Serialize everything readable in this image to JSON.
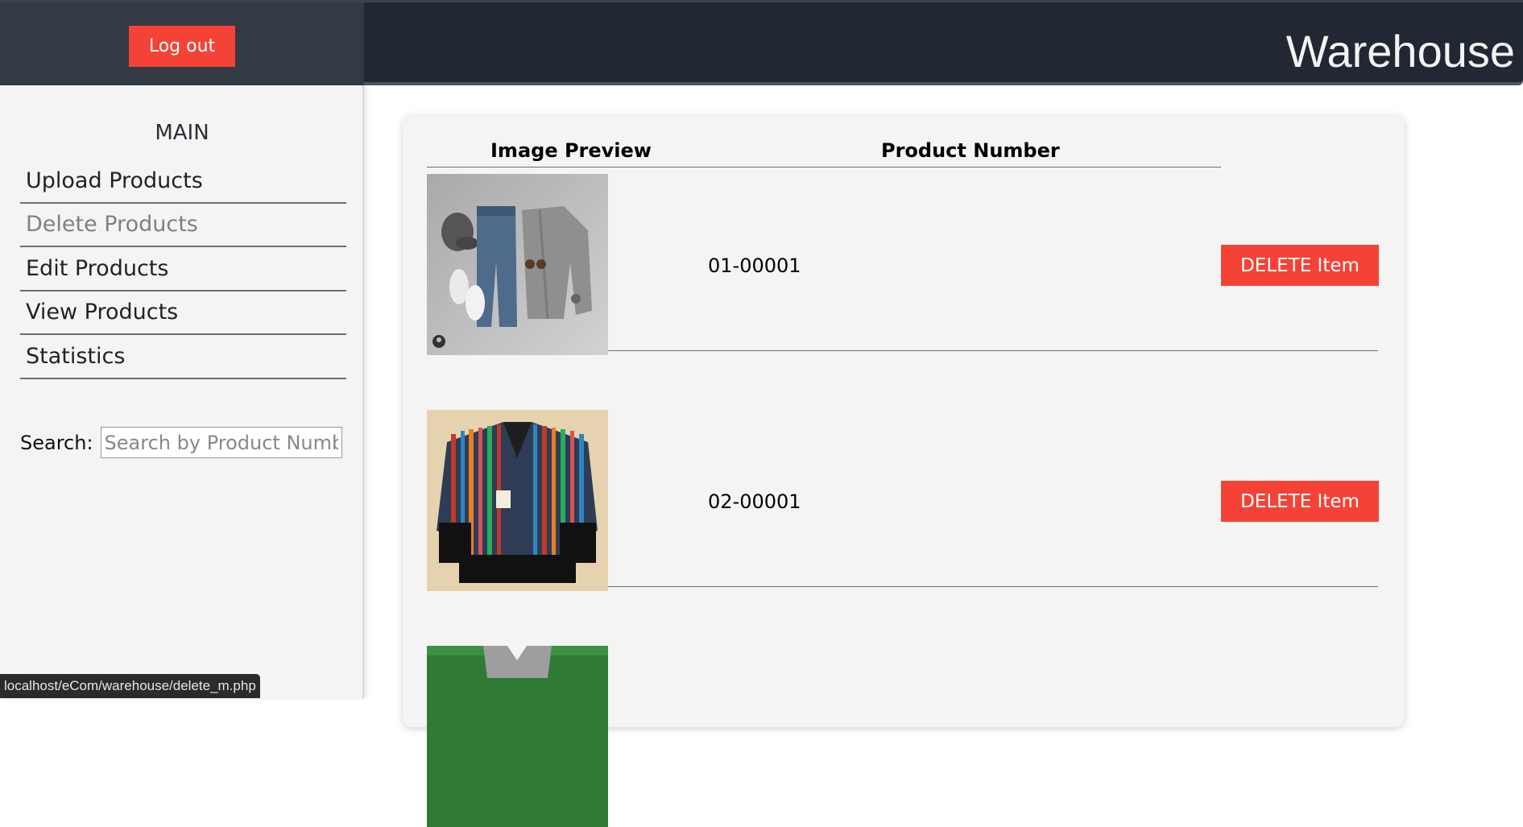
{
  "header": {
    "logout_label": "Log out",
    "brand": "Warehouse"
  },
  "sidebar": {
    "title": "MAIN",
    "items": [
      {
        "label": "Upload Products",
        "active": false
      },
      {
        "label": "Delete Products",
        "active": true
      },
      {
        "label": "Edit Products",
        "active": false
      },
      {
        "label": "View Products",
        "active": false
      },
      {
        "label": "Statistics",
        "active": false
      }
    ],
    "search_label": "Search:",
    "search_placeholder": "Search by Product Number"
  },
  "table": {
    "headers": [
      "Image Preview",
      "Product Number"
    ],
    "rows": [
      {
        "product_number": "01-00001",
        "delete_label": "DELETE Item",
        "image": "flat-lay-outfit-cap-jeans-sneakers-cardigan"
      },
      {
        "product_number": "02-00001",
        "delete_label": "DELETE Item",
        "image": "striped-fringe-jacket"
      },
      {
        "product_number": "",
        "delete_label": "",
        "image": "green-grass-shirt"
      }
    ]
  },
  "status_bar": {
    "url": "localhost/eCom/warehouse/delete_m.php"
  },
  "colors": {
    "header_bg": "#212834",
    "sidebar_bg": "#f4f4f4",
    "accent_red": "#f44336"
  }
}
